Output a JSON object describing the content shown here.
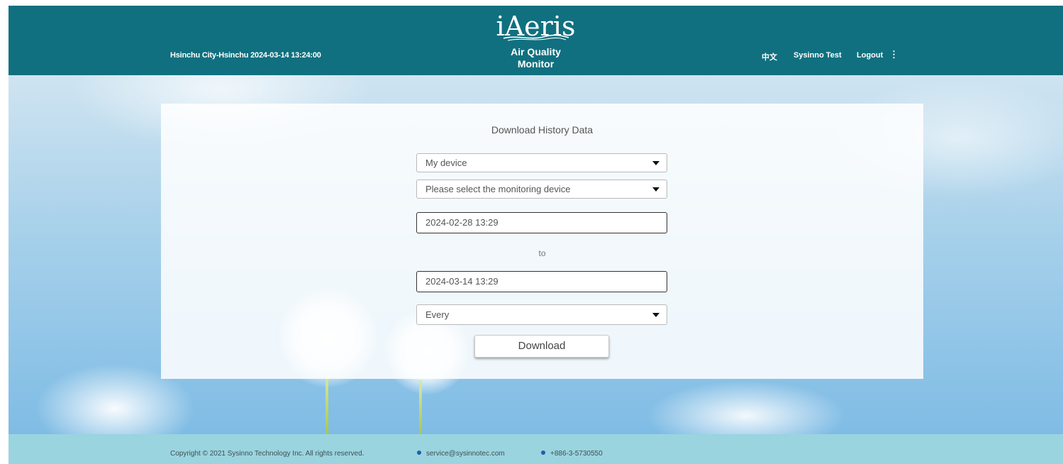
{
  "header": {
    "location_time": "Hsinchu City-Hsinchu 2024-03-14 13:24:00",
    "logo": "iAeris",
    "subtitle_line1": "Air Quality",
    "subtitle_line2": "Monitor",
    "lang_label": "中文",
    "user_label": "Sysinno Test",
    "logout_label": "Logout",
    "more_label": "⋮"
  },
  "form": {
    "title": "Download History Data",
    "device_group": {
      "value": "My device"
    },
    "device": {
      "value": "Please select the monitoring device"
    },
    "start_time": {
      "value": "2024-02-28 13:29"
    },
    "to_label": "to",
    "end_time": {
      "value": "2024-03-14 13:29"
    },
    "interval": {
      "value": "Every"
    },
    "download_label": "Download"
  },
  "footer": {
    "copyright": "Copyright © 2021 Sysinno Technology Inc. All rights reserved.",
    "email": "service@sysinnotec.com",
    "phone": "+886-3-5730550"
  },
  "colors": {
    "header_bg": "#10707f",
    "footer_bg": "#9ad4df",
    "bullet": "#1f5fa8"
  },
  "icons": [
    "caret-down-icon",
    "more-vert-icon",
    "bullet-icon"
  ]
}
